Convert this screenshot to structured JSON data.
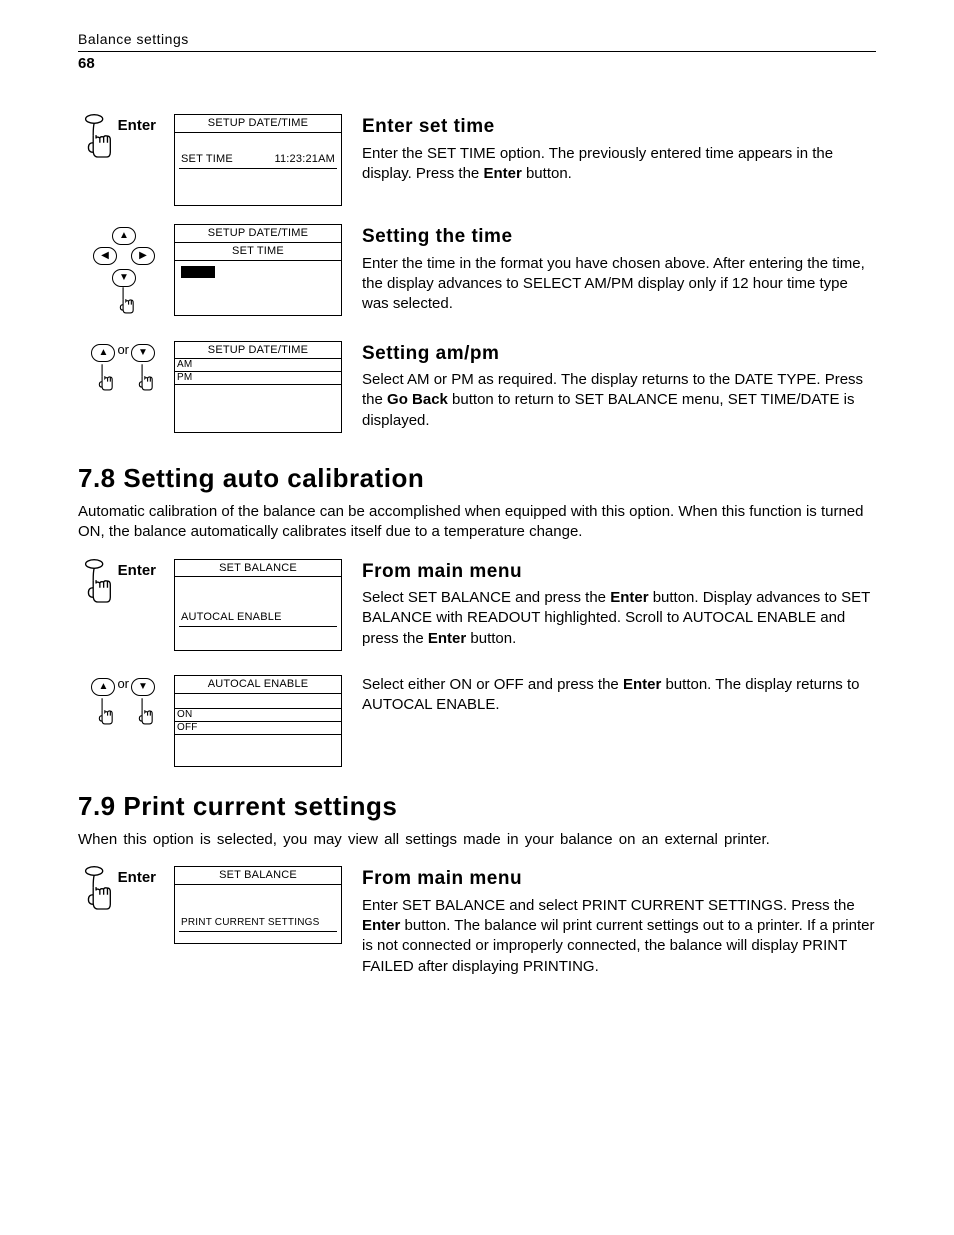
{
  "header": {
    "chapter": "Balance settings",
    "page": "68"
  },
  "labels": {
    "enter": "Enter",
    "or": "or"
  },
  "s1": {
    "heading": "Enter set time",
    "para_a": "Enter the SET TIME option. The previously entered time appears in the display. Press the ",
    "bold": "Enter",
    "para_b": " button.",
    "screen": {
      "title": "SETUP DATE/TIME",
      "left": "SET TIME",
      "right": "11:23:21AM"
    }
  },
  "s2": {
    "heading": "Setting the time",
    "para": "Enter the time in the format you have chosen above. After entering the time, the display advances to SELECT AM/PM display only if 12 hour time type was selected.",
    "screen": {
      "title": "SETUP DATE/TIME",
      "sub": "SET TIME"
    }
  },
  "s3": {
    "heading": "Setting am/pm",
    "para_a": "Select AM or PM as required. The display returns to the DATE TYPE. Press the ",
    "bold": "Go Back",
    "para_b": " button to return to SET BALANCE menu, SET TIME/DATE is displayed.",
    "screen": {
      "title": "SETUP  DATE/TIME",
      "opt1": "AM",
      "opt2": "PM"
    }
  },
  "s78": {
    "heading": "7.8   Setting auto calibration",
    "intro": "Automatic calibration of the balance can be accomplished when equipped with this option. When this function is turned ON, the balance automatically calibrates itself due to a temperature change."
  },
  "s4": {
    "heading": "From main menu",
    "para_a": "Select SET BALANCE and press the ",
    "bold1": "Enter",
    "para_b": " button. Display advances to SET BALANCE with READOUT highlighted. Scroll to AUTOCAL ENABLE and press the ",
    "bold2": "Enter",
    "para_c": " button.",
    "screen": {
      "title": "SET BALANCE",
      "line": "AUTOCAL ENABLE"
    }
  },
  "s5": {
    "para_a": "Select either ON or OFF and press the ",
    "bold": "Enter",
    "para_b": " button. The display returns to AUTOCAL ENABLE.",
    "screen": {
      "title": "AUTOCAL ENABLE",
      "opt1": "ON",
      "opt2": "OFF"
    }
  },
  "s79": {
    "heading": "7.9  Print current settings",
    "intro": "When this option is selected, you may view all settings made in your balance on an external printer."
  },
  "s6": {
    "heading": "From main menu",
    "para_a": "Enter SET BALANCE and select PRINT CURRENT SETTINGS. Press the ",
    "bold": "Enter",
    "para_b": " button. The balance wil print current settings out to a printer. If a printer is not connected or improperly connected, the balance will display PRINT FAILED after displaying PRINTING.",
    "screen": {
      "title": "SET BALANCE",
      "line": "PRINT CURRENT SETTINGS"
    }
  }
}
